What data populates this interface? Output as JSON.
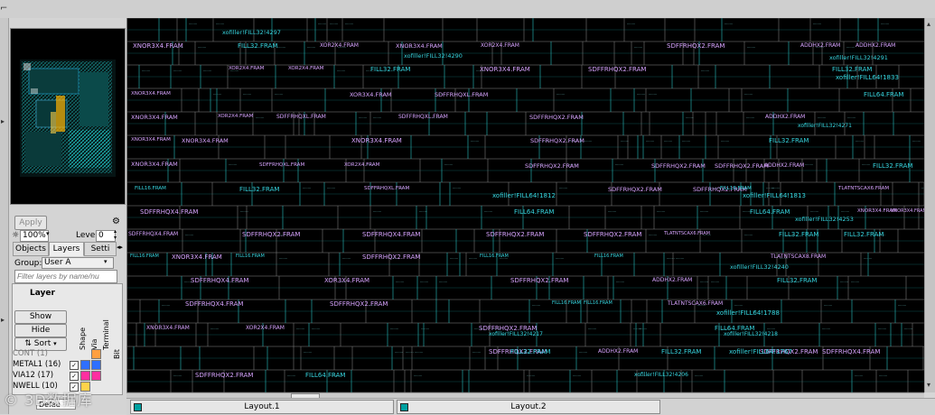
{
  "panel": {
    "apply_label": "Apply",
    "zoom_value": "100%",
    "level_label": "Level",
    "level_value": "0",
    "tabs": [
      "Objects",
      "Layers",
      "Setti"
    ],
    "group_label": "Group:",
    "group_value": "User A",
    "filter_placeholder": "Filter layers by name/nu",
    "layer_header": "Layer",
    "buttons": {
      "show": "Show",
      "hide": "Hide",
      "sort": "Sort"
    },
    "col_headers": [
      "Shape",
      "Via",
      "Terminal",
      "Bit"
    ],
    "layers": [
      {
        "name": "CONT (1)",
        "color": "#ff9f40"
      },
      {
        "name": "METAL1 (16)",
        "color": "#2f6fff"
      },
      {
        "name": "VIA12 (17)",
        "color": "#ff2fa0"
      },
      {
        "name": "NWELL (10)",
        "color": "#ffd24a"
      }
    ],
    "bottom_select": "Defau"
  },
  "bottom_tabs": [
    "Layout.1",
    "Layout.2"
  ],
  "watermark": "© 3D数据库",
  "layout_cells": [
    {
      "text": "xofiller!FILL32!4297",
      "c": "#37d6e0",
      "s": 6.5
    },
    {
      "text": "XNOR3X4.FRAM",
      "c": "#d8a4ff",
      "s": 7
    },
    {
      "text": "FILL32.FRAM",
      "c": "#37d6e0",
      "s": 7
    },
    {
      "text": "XOR2X4.FRAM",
      "c": "#d8a4ff",
      "s": 6
    },
    {
      "text": "XNOR3X4.FRAM",
      "c": "#d8a4ff",
      "s": 6.5
    },
    {
      "text": "XOR2X4.FRAM",
      "c": "#d8a4ff",
      "s": 6
    },
    {
      "text": "SDFFRHQX2.FRAM",
      "c": "#d8a4ff",
      "s": 7
    },
    {
      "text": "ADDHX2.FRAM",
      "c": "#d8a4ff",
      "s": 6
    },
    {
      "text": "ADDHX2.FRAM",
      "c": "#d8a4ff",
      "s": 6
    },
    {
      "text": "xofiller!FILL32!4290",
      "c": "#37d6e0",
      "s": 6.5
    },
    {
      "text": "xofiller!FILL32!4291",
      "c": "#37d6e0",
      "s": 6.5
    },
    {
      "text": "XOR2X4.FRAM",
      "c": "#d8a4ff",
      "s": 5.5
    },
    {
      "text": "XOR2X4.FRAM",
      "c": "#d8a4ff",
      "s": 5.5
    },
    {
      "text": "FILL32.FRAM",
      "c": "#37d6e0",
      "s": 7
    },
    {
      "text": "XNOR3X4.FRAM",
      "c": "#d8a4ff",
      "s": 7
    },
    {
      "text": "SDFFRHQX2.FRAM",
      "c": "#d8a4ff",
      "s": 7
    },
    {
      "text": "FILL32.FRAM",
      "c": "#37d6e0",
      "s": 7
    },
    {
      "text": "xofiller!FILL64!1833",
      "c": "#37d6e0",
      "s": 7
    },
    {
      "text": "XNOR3X4.FRAM",
      "c": "#d8a4ff",
      "s": 5.5
    },
    {
      "text": "XOR3X4.FRAM",
      "c": "#d8a4ff",
      "s": 6.5
    },
    {
      "text": "SDFFRHQXL.FRAM",
      "c": "#d8a4ff",
      "s": 6.5
    },
    {
      "text": "FILL64.FRAM",
      "c": "#37d6e0",
      "s": 7
    },
    {
      "text": "XNOR3X4.FRAM",
      "c": "#d8a4ff",
      "s": 6.5
    },
    {
      "text": "XOR2X4.FRAM",
      "c": "#d8a4ff",
      "s": 5.5
    },
    {
      "text": "SDFFRHQXL.FRAM",
      "c": "#d8a4ff",
      "s": 6
    },
    {
      "text": "SDFFRHQXL.FRAM",
      "c": "#d8a4ff",
      "s": 6
    },
    {
      "text": "SDFFRHQX2.FRAM",
      "c": "#d8a4ff",
      "s": 6.5
    },
    {
      "text": "ADDHX2.FRAM",
      "c": "#d8a4ff",
      "s": 6
    },
    {
      "text": "xofiller!FILL32!4271",
      "c": "#37d6e0",
      "s": 6
    },
    {
      "text": "XNOR3X4.FRAM",
      "c": "#d8a4ff",
      "s": 5.5
    },
    {
      "text": "XNOR3X4.FRAM",
      "c": "#d8a4ff",
      "s": 6.5
    },
    {
      "text": "XNOR3X4.FRAM",
      "c": "#d8a4ff",
      "s": 7
    },
    {
      "text": "SDFFRHQX2.FRAM",
      "c": "#d8a4ff",
      "s": 6.5
    },
    {
      "text": "FILL32.FRAM",
      "c": "#37d6e0",
      "s": 7
    },
    {
      "text": "SDFFRHQXL.FRAM",
      "c": "#d8a4ff",
      "s": 5.5
    },
    {
      "text": "XNOR3X4.FRAM",
      "c": "#d8a4ff",
      "s": 6.5
    },
    {
      "text": "XOR2X4.FRAM",
      "c": "#d8a4ff",
      "s": 5.5
    },
    {
      "text": "SDFFRHQX2.FRAM",
      "c": "#d8a4ff",
      "s": 6.5
    },
    {
      "text": "SDFFRHQX2.FRAM",
      "c": "#d8a4ff",
      "s": 6.5
    },
    {
      "text": "SDFFRHQX2.FRAM",
      "c": "#d8a4ff",
      "s": 6.5
    },
    {
      "text": "ADDHX2.FRAM",
      "c": "#d8a4ff",
      "s": 6
    },
    {
      "text": "FILL32.FRAM",
      "c": "#37d6e0",
      "s": 7
    },
    {
      "text": "FILL32.FRAM",
      "c": "#37d6e0",
      "s": 7
    },
    {
      "text": "SDFFRHQXL.FRAM",
      "c": "#d8a4ff",
      "s": 5.5
    },
    {
      "text": "SDFFRHQX2.FRAM",
      "c": "#d8a4ff",
      "s": 6.5
    },
    {
      "text": "SDFFRHQX2.FRAM",
      "c": "#d8a4ff",
      "s": 6.5
    },
    {
      "text": "TLATNTSCAX6.FRAM",
      "c": "#d8a4ff",
      "s": 5.5
    },
    {
      "text": "FILL16.FRAM",
      "c": "#37d6e0",
      "s": 5.5
    },
    {
      "text": "FILL16.FRAM",
      "c": "#37d6e0",
      "s": 5.5
    },
    {
      "text": "SDFFRHQX4.FRAM",
      "c": "#d8a4ff",
      "s": 7
    },
    {
      "text": "xofiller!FILL64!1812",
      "c": "#37d6e0",
      "s": 7
    },
    {
      "text": "xofiller!FILL64!1813",
      "c": "#37d6e0",
      "s": 7
    },
    {
      "text": "XNOR3X4.FRAM",
      "c": "#d8a4ff",
      "s": 5.5
    },
    {
      "text": "FILL64.FRAM",
      "c": "#37d6e0",
      "s": 7
    },
    {
      "text": "FILL64.FRAM",
      "c": "#37d6e0",
      "s": 7
    },
    {
      "text": "XNOR3X4.FRAM",
      "c": "#d8a4ff",
      "s": 5
    },
    {
      "text": "xofiller!FILL32!4253",
      "c": "#37d6e0",
      "s": 6.5
    },
    {
      "text": "SDFFRHQX4.FRAM",
      "c": "#d8a4ff",
      "s": 6
    },
    {
      "text": "SDFFRHQX2.FRAM",
      "c": "#d8a4ff",
      "s": 7
    },
    {
      "text": "SDFFRHQX4.FRAM",
      "c": "#d8a4ff",
      "s": 7
    },
    {
      "text": "SDFFRHQX2.FRAM",
      "c": "#d8a4ff",
      "s": 7
    },
    {
      "text": "SDFFRHQX2.FRAM",
      "c": "#d8a4ff",
      "s": 7
    },
    {
      "text": "TLATNTSCAX6.FRAM",
      "c": "#d8a4ff",
      "s": 5
    },
    {
      "text": "FILL32.FRAM",
      "c": "#37d6e0",
      "s": 7
    },
    {
      "text": "FILL32.FRAM",
      "c": "#37d6e0",
      "s": 7
    },
    {
      "text": "XNOR3X4.FRAM",
      "c": "#d8a4ff",
      "s": 7
    },
    {
      "text": "SDFFRHQX2.FRAM",
      "c": "#d8a4ff",
      "s": 7
    },
    {
      "text": "FILL16.FRAM",
      "c": "#37d6e0",
      "s": 5
    },
    {
      "text": "FILL16.FRAM",
      "c": "#37d6e0",
      "s": 5
    },
    {
      "text": "FILL16.FRAM",
      "c": "#37d6e0",
      "s": 5
    },
    {
      "text": "FILL16.FRAM",
      "c": "#37d6e0",
      "s": 5
    },
    {
      "text": "TLATNTSCAX8.FRAM",
      "c": "#d8a4ff",
      "s": 6
    },
    {
      "text": "xofiller!FILL32!4240",
      "c": "#37d6e0",
      "s": 6.5
    },
    {
      "text": "SDFFRHQX4.FRAM",
      "c": "#d8a4ff",
      "s": 7
    },
    {
      "text": "XOR3X4.FRAM",
      "c": "#d8a4ff",
      "s": 7
    },
    {
      "text": "SDFFRHQX2.FRAM",
      "c": "#d8a4ff",
      "s": 7
    },
    {
      "text": "ADDHX2.FRAM",
      "c": "#d8a4ff",
      "s": 6
    },
    {
      "text": "FILL32.FRAM",
      "c": "#37d6e0",
      "s": 7
    },
    {
      "text": "SDFFRHQX4.FRAM",
      "c": "#d8a4ff",
      "s": 7
    },
    {
      "text": "SDFFRHQX2.FRAM",
      "c": "#d8a4ff",
      "s": 7
    },
    {
      "text": "TLATNTSCAX6.FRAM",
      "c": "#d8a4ff",
      "s": 6
    },
    {
      "text": "xofiller!FILL64!1788",
      "c": "#37d6e0",
      "s": 7
    },
    {
      "text": "FILL16.FRAM",
      "c": "#37d6e0",
      "s": 5
    },
    {
      "text": "FILL16.FRAM",
      "c": "#37d6e0",
      "s": 5
    },
    {
      "text": "XNOR3X4.FRAM",
      "c": "#d8a4ff",
      "s": 6
    },
    {
      "text": "XOR2X4.FRAM",
      "c": "#d8a4ff",
      "s": 6
    },
    {
      "text": "SDFFRHQX2.FRAM",
      "c": "#d8a4ff",
      "s": 7
    },
    {
      "text": "FILL64.FRAM",
      "c": "#37d6e0",
      "s": 7
    },
    {
      "text": "xofiller!FILL32!4217",
      "c": "#37d6e0",
      "s": 6
    },
    {
      "text": "xofiller!FILL32!4218",
      "c": "#37d6e0",
      "s": 6
    },
    {
      "text": "SDFFRHQX2.FRAM",
      "c": "#d8a4ff",
      "s": 7
    },
    {
      "text": "SDFFRHQX2.FRAM",
      "c": "#d8a4ff",
      "s": 7
    },
    {
      "text": "FILL32.FRAM",
      "c": "#37d6e0",
      "s": 7
    },
    {
      "text": "ADDHX2.FRAM",
      "c": "#d8a4ff",
      "s": 6
    },
    {
      "text": "FILL32.FRAM",
      "c": "#37d6e0",
      "s": 7
    },
    {
      "text": "xofiller!FILL64!1767",
      "c": "#37d6e0",
      "s": 7
    },
    {
      "text": "SDFFRHQX4.FRAM",
      "c": "#d8a4ff",
      "s": 7
    },
    {
      "text": "SDFFRHQX2.FRAM",
      "c": "#d8a4ff",
      "s": 7
    },
    {
      "text": "FILL64.FRAM",
      "c": "#37d6e0",
      "s": 7
    },
    {
      "text": "xofiller!FILL32!4206",
      "c": "#37d6e0",
      "s": 6
    }
  ]
}
